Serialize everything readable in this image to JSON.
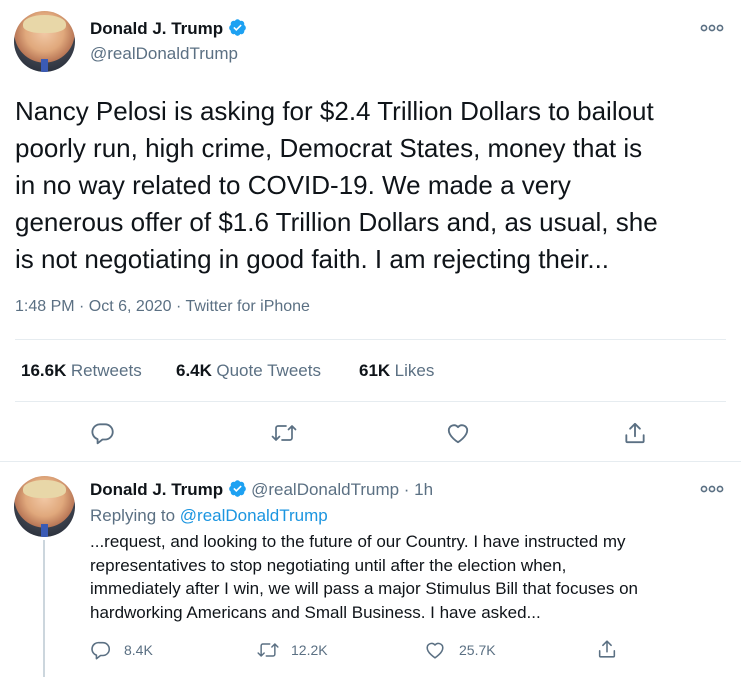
{
  "main_tweet": {
    "author_name": "Donald J. Trump",
    "author_handle": "@realDonaldTrump",
    "text_lines": [
      "Nancy Pelosi is asking for $2.4 Trillion Dollars to bailout",
      "poorly run, high crime, Democrat States, money that is",
      "in no way related to COVID-19. We made a very",
      "generous offer of $1.6 Trillion Dollars and, as usual, she",
      "is not negotiating in good faith. I am rejecting their..."
    ],
    "timestamp": "1:48 PM · Oct 6, 2020 · ",
    "source": "Twitter for iPhone",
    "stats": {
      "retweets_count": "16.6K",
      "retweets_label": "Retweets",
      "quotes_count": "6.4K",
      "quotes_label": "Quote Tweets",
      "likes_count": "61K",
      "likes_label": "Likes"
    }
  },
  "reply_tweet": {
    "author_name": "Donald J. Trump",
    "author_handle": "@realDonaldTrump",
    "time": " · 1h",
    "replying_prefix": "Replying to ",
    "replying_handle": "@realDonaldTrump",
    "text_lines": [
      "...request, and looking to the future of our Country. I have instructed my",
      "representatives to stop negotiating until after the election when,",
      "immediately after I win, we will pass a major Stimulus Bill that focuses on",
      "hardworking Americans and Small Business. I have asked..."
    ],
    "reply_count": "8.4K",
    "retweet_count": "12.2K",
    "like_count": "25.7K"
  },
  "colors": {
    "text": "#0f1419",
    "secondary": "#5b7083",
    "accent": "#1b95e0",
    "divider": "#e6ecf0"
  },
  "icons": [
    "verified-badge-icon",
    "more-options-icon",
    "reply-icon",
    "retweet-icon",
    "like-icon",
    "share-icon"
  ]
}
